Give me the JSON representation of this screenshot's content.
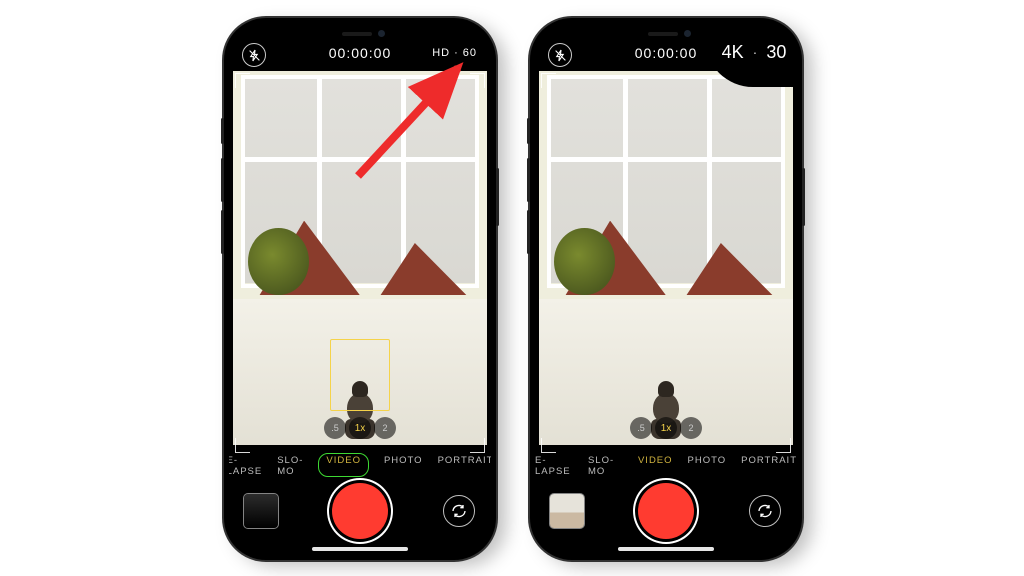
{
  "phones": {
    "left": {
      "topbar": {
        "timer": "00:00:00",
        "resolution": "HD",
        "fps": "60"
      },
      "zoom": {
        "wide": ".5",
        "normal": "1x",
        "tele": "2"
      },
      "modes": {
        "m0": "E-LAPSE",
        "m1": "SLO-MO",
        "m2": "VIDEO",
        "m3": "PHOTO",
        "m4": "PORTRAIT"
      }
    },
    "right": {
      "topbar": {
        "timer": "00:00:00",
        "resolution": "4K",
        "fps": "30"
      },
      "zoom": {
        "wide": ".5",
        "normal": "1x",
        "tele": "2"
      },
      "modes": {
        "m0": "E-LAPSE",
        "m1": "SLO-MO",
        "m2": "VIDEO",
        "m3": "PHOTO",
        "m4": "PORTRAIT"
      }
    }
  },
  "icons": {
    "flash": "flash-off-icon",
    "flip": "camera-flip-icon"
  },
  "colors": {
    "active_mode": "#f5d34a",
    "record": "#ff3b30",
    "highlight_ring": "#49ff3c",
    "arrow": "#ee2b2b"
  }
}
